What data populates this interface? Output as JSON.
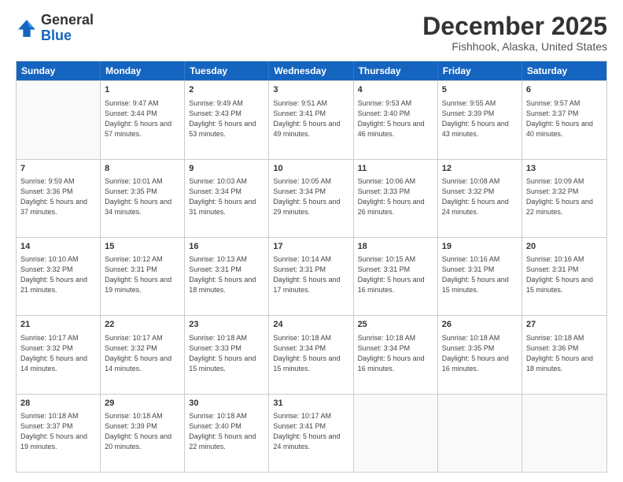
{
  "header": {
    "logo_general": "General",
    "logo_blue": "Blue",
    "month_title": "December 2025",
    "location": "Fishhook, Alaska, United States"
  },
  "days_of_week": [
    "Sunday",
    "Monday",
    "Tuesday",
    "Wednesday",
    "Thursday",
    "Friday",
    "Saturday"
  ],
  "weeks": [
    [
      {
        "day": "",
        "sunrise": "",
        "sunset": "",
        "daylight": ""
      },
      {
        "day": "1",
        "sunrise": "Sunrise: 9:47 AM",
        "sunset": "Sunset: 3:44 PM",
        "daylight": "Daylight: 5 hours and 57 minutes."
      },
      {
        "day": "2",
        "sunrise": "Sunrise: 9:49 AM",
        "sunset": "Sunset: 3:43 PM",
        "daylight": "Daylight: 5 hours and 53 minutes."
      },
      {
        "day": "3",
        "sunrise": "Sunrise: 9:51 AM",
        "sunset": "Sunset: 3:41 PM",
        "daylight": "Daylight: 5 hours and 49 minutes."
      },
      {
        "day": "4",
        "sunrise": "Sunrise: 9:53 AM",
        "sunset": "Sunset: 3:40 PM",
        "daylight": "Daylight: 5 hours and 46 minutes."
      },
      {
        "day": "5",
        "sunrise": "Sunrise: 9:55 AM",
        "sunset": "Sunset: 3:39 PM",
        "daylight": "Daylight: 5 hours and 43 minutes."
      },
      {
        "day": "6",
        "sunrise": "Sunrise: 9:57 AM",
        "sunset": "Sunset: 3:37 PM",
        "daylight": "Daylight: 5 hours and 40 minutes."
      }
    ],
    [
      {
        "day": "7",
        "sunrise": "Sunrise: 9:59 AM",
        "sunset": "Sunset: 3:36 PM",
        "daylight": "Daylight: 5 hours and 37 minutes."
      },
      {
        "day": "8",
        "sunrise": "Sunrise: 10:01 AM",
        "sunset": "Sunset: 3:35 PM",
        "daylight": "Daylight: 5 hours and 34 minutes."
      },
      {
        "day": "9",
        "sunrise": "Sunrise: 10:03 AM",
        "sunset": "Sunset: 3:34 PM",
        "daylight": "Daylight: 5 hours and 31 minutes."
      },
      {
        "day": "10",
        "sunrise": "Sunrise: 10:05 AM",
        "sunset": "Sunset: 3:34 PM",
        "daylight": "Daylight: 5 hours and 29 minutes."
      },
      {
        "day": "11",
        "sunrise": "Sunrise: 10:06 AM",
        "sunset": "Sunset: 3:33 PM",
        "daylight": "Daylight: 5 hours and 26 minutes."
      },
      {
        "day": "12",
        "sunrise": "Sunrise: 10:08 AM",
        "sunset": "Sunset: 3:32 PM",
        "daylight": "Daylight: 5 hours and 24 minutes."
      },
      {
        "day": "13",
        "sunrise": "Sunrise: 10:09 AM",
        "sunset": "Sunset: 3:32 PM",
        "daylight": "Daylight: 5 hours and 22 minutes."
      }
    ],
    [
      {
        "day": "14",
        "sunrise": "Sunrise: 10:10 AM",
        "sunset": "Sunset: 3:32 PM",
        "daylight": "Daylight: 5 hours and 21 minutes."
      },
      {
        "day": "15",
        "sunrise": "Sunrise: 10:12 AM",
        "sunset": "Sunset: 3:31 PM",
        "daylight": "Daylight: 5 hours and 19 minutes."
      },
      {
        "day": "16",
        "sunrise": "Sunrise: 10:13 AM",
        "sunset": "Sunset: 3:31 PM",
        "daylight": "Daylight: 5 hours and 18 minutes."
      },
      {
        "day": "17",
        "sunrise": "Sunrise: 10:14 AM",
        "sunset": "Sunset: 3:31 PM",
        "daylight": "Daylight: 5 hours and 17 minutes."
      },
      {
        "day": "18",
        "sunrise": "Sunrise: 10:15 AM",
        "sunset": "Sunset: 3:31 PM",
        "daylight": "Daylight: 5 hours and 16 minutes."
      },
      {
        "day": "19",
        "sunrise": "Sunrise: 10:16 AM",
        "sunset": "Sunset: 3:31 PM",
        "daylight": "Daylight: 5 hours and 15 minutes."
      },
      {
        "day": "20",
        "sunrise": "Sunrise: 10:16 AM",
        "sunset": "Sunset: 3:31 PM",
        "daylight": "Daylight: 5 hours and 15 minutes."
      }
    ],
    [
      {
        "day": "21",
        "sunrise": "Sunrise: 10:17 AM",
        "sunset": "Sunset: 3:32 PM",
        "daylight": "Daylight: 5 hours and 14 minutes."
      },
      {
        "day": "22",
        "sunrise": "Sunrise: 10:17 AM",
        "sunset": "Sunset: 3:32 PM",
        "daylight": "Daylight: 5 hours and 14 minutes."
      },
      {
        "day": "23",
        "sunrise": "Sunrise: 10:18 AM",
        "sunset": "Sunset: 3:33 PM",
        "daylight": "Daylight: 5 hours and 15 minutes."
      },
      {
        "day": "24",
        "sunrise": "Sunrise: 10:18 AM",
        "sunset": "Sunset: 3:34 PM",
        "daylight": "Daylight: 5 hours and 15 minutes."
      },
      {
        "day": "25",
        "sunrise": "Sunrise: 10:18 AM",
        "sunset": "Sunset: 3:34 PM",
        "daylight": "Daylight: 5 hours and 16 minutes."
      },
      {
        "day": "26",
        "sunrise": "Sunrise: 10:18 AM",
        "sunset": "Sunset: 3:35 PM",
        "daylight": "Daylight: 5 hours and 16 minutes."
      },
      {
        "day": "27",
        "sunrise": "Sunrise: 10:18 AM",
        "sunset": "Sunset: 3:36 PM",
        "daylight": "Daylight: 5 hours and 18 minutes."
      }
    ],
    [
      {
        "day": "28",
        "sunrise": "Sunrise: 10:18 AM",
        "sunset": "Sunset: 3:37 PM",
        "daylight": "Daylight: 5 hours and 19 minutes."
      },
      {
        "day": "29",
        "sunrise": "Sunrise: 10:18 AM",
        "sunset": "Sunset: 3:39 PM",
        "daylight": "Daylight: 5 hours and 20 minutes."
      },
      {
        "day": "30",
        "sunrise": "Sunrise: 10:18 AM",
        "sunset": "Sunset: 3:40 PM",
        "daylight": "Daylight: 5 hours and 22 minutes."
      },
      {
        "day": "31",
        "sunrise": "Sunrise: 10:17 AM",
        "sunset": "Sunset: 3:41 PM",
        "daylight": "Daylight: 5 hours and 24 minutes."
      },
      {
        "day": "",
        "sunrise": "",
        "sunset": "",
        "daylight": ""
      },
      {
        "day": "",
        "sunrise": "",
        "sunset": "",
        "daylight": ""
      },
      {
        "day": "",
        "sunrise": "",
        "sunset": "",
        "daylight": ""
      }
    ]
  ]
}
